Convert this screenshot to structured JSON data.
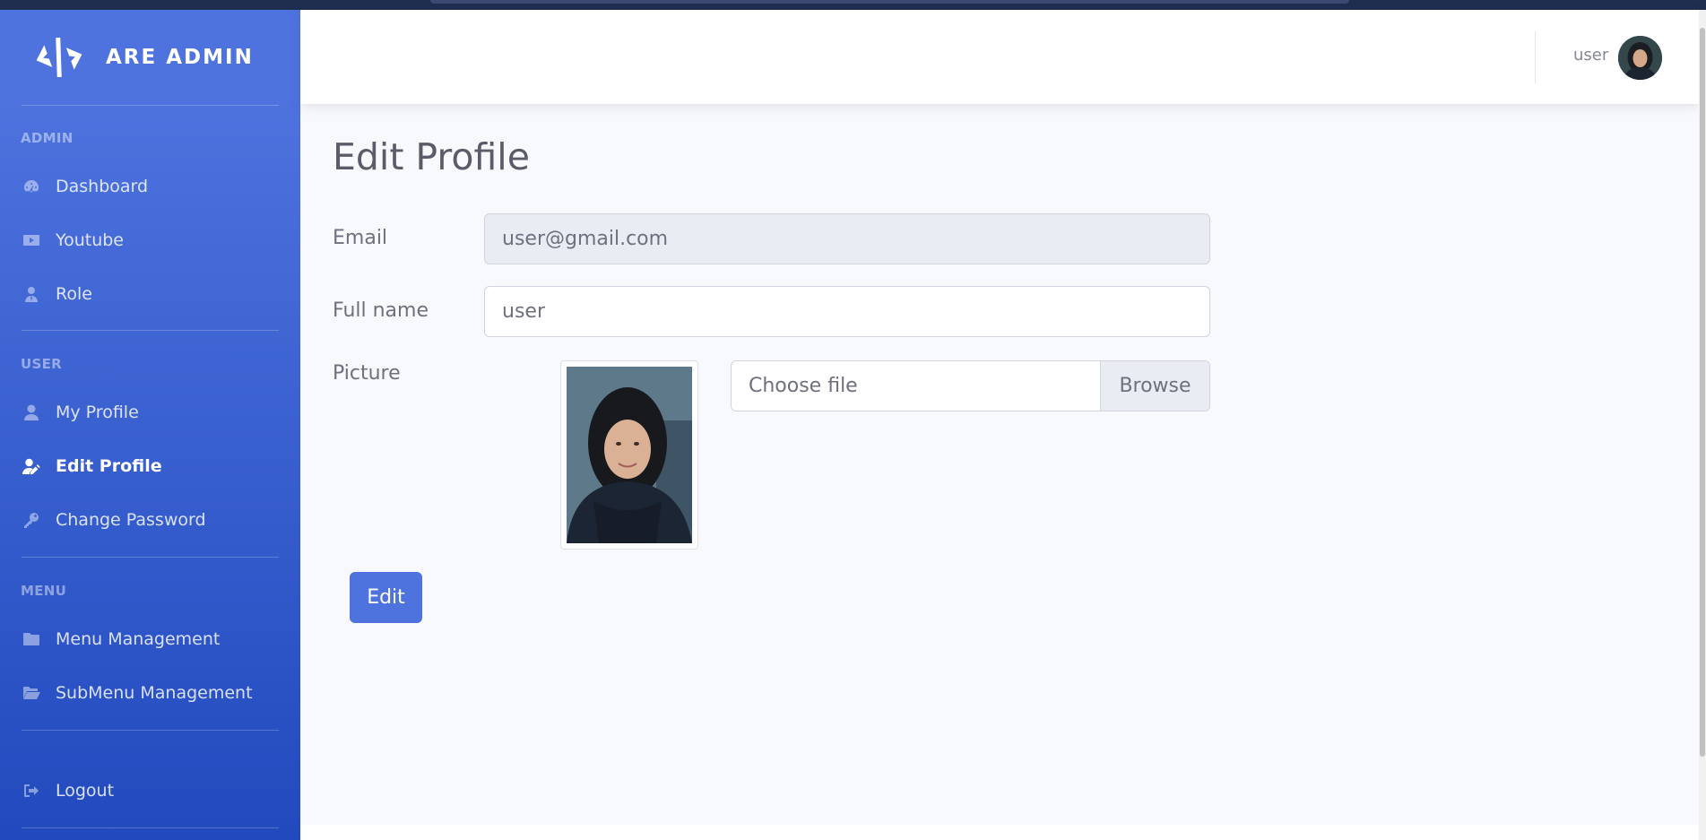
{
  "brand": {
    "name": "ARE ADMIN",
    "logo_icon": "code-brackets-icon"
  },
  "sidebar": {
    "sections": [
      {
        "heading": "ADMIN",
        "items": [
          {
            "label": "Dashboard",
            "icon": "tachometer-icon"
          },
          {
            "label": "Youtube",
            "icon": "youtube-icon"
          },
          {
            "label": "Role",
            "icon": "user-tie-icon"
          }
        ]
      },
      {
        "heading": "USER",
        "items": [
          {
            "label": "My Profile",
            "icon": "user-icon"
          },
          {
            "label": "Edit Profile",
            "icon": "user-edit-icon",
            "active": true
          },
          {
            "label": "Change Password",
            "icon": "key-icon"
          }
        ]
      },
      {
        "heading": "MENU",
        "items": [
          {
            "label": "Menu Management",
            "icon": "folder-icon"
          },
          {
            "label": "SubMenu Management",
            "icon": "folder-open-icon"
          }
        ]
      }
    ],
    "logout": {
      "label": "Logout",
      "icon": "sign-out-icon"
    }
  },
  "topbar": {
    "user_name": "user"
  },
  "page": {
    "title": "Edit Profile",
    "form": {
      "email_label": "Email",
      "email_value": "user@gmail.com",
      "fullname_label": "Full name",
      "fullname_value": "user",
      "picture_label": "Picture",
      "file_placeholder": "Choose file",
      "browse_label": "Browse",
      "submit_label": "Edit"
    }
  },
  "colors": {
    "primary": "#4e73df",
    "sidebar_gradient_end": "#224abe",
    "page_background": "#f8f9fc",
    "text_muted": "#6e707e"
  }
}
